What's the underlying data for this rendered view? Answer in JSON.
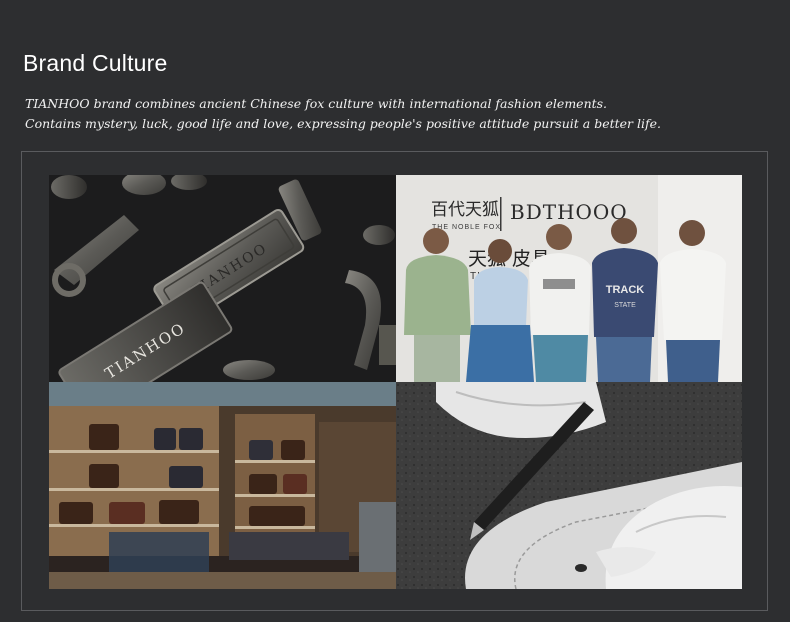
{
  "section": {
    "title": "Brand Culture",
    "description_lines": [
      "TIANHOO brand combines ancient Chinese fox culture with international fashion elements.",
      "Contains mystery, luck, good life and love, expressing people's positive attitude pursuit a better life."
    ]
  },
  "gallery": {
    "hardware": {
      "tag_text_1": "TIANHOO",
      "tag_text_2": "TIANHOO"
    },
    "team": {
      "sign_chinese": "百代天狐",
      "sign_english": "THE NOBLE FOX",
      "sign_brand": "BDTHOOO",
      "wall_chinese": "天狐 皮具",
      "wall_english": "TIANHOO",
      "shirt_text_1": "TRACK",
      "shirt_text_2": "STATE"
    }
  },
  "colors": {
    "background": "#2d2e30",
    "frame_border": "#5a5b5e",
    "text": "#ffffff"
  }
}
